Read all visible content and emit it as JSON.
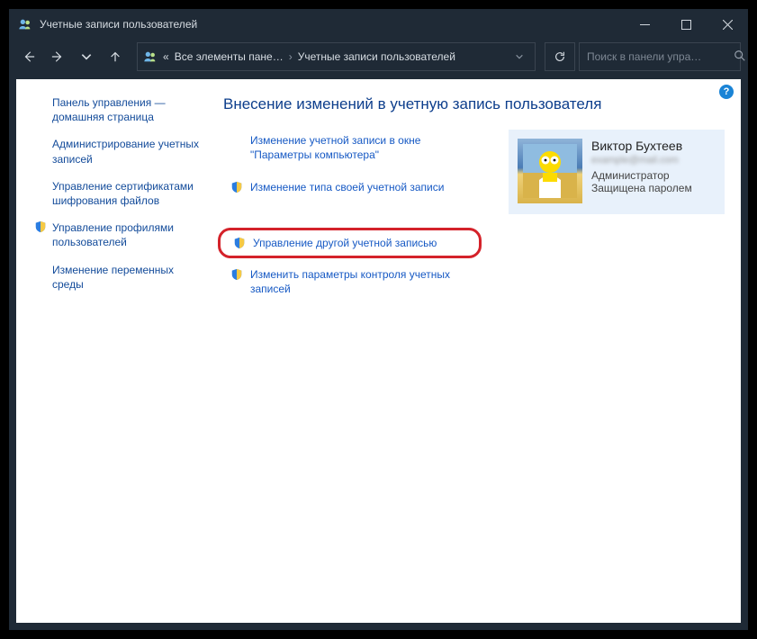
{
  "window": {
    "title": "Учетные записи пользователей"
  },
  "breadcrumb": {
    "prefix": "«",
    "item1": "Все элементы пане…",
    "item2": "Учетные записи пользователей"
  },
  "search": {
    "placeholder": "Поиск в панели упра…"
  },
  "sidebar": {
    "items": [
      {
        "label": "Панель управления — домашняя страница",
        "shield": false
      },
      {
        "label": "Администрирование учетных записей",
        "shield": false
      },
      {
        "label": "Управление сертификатами шифрования файлов",
        "shield": false
      },
      {
        "label": "Управление профилями пользователей",
        "shield": true
      },
      {
        "label": "Изменение переменных среды",
        "shield": false
      }
    ]
  },
  "main": {
    "heading": "Внесение изменений в учетную запись пользователя",
    "actions": [
      {
        "label": "Изменение учетной записи в окне \"Параметры компьютера\"",
        "shield": false,
        "highlighted": false
      },
      {
        "label": "Изменение типа своей учетной записи",
        "shield": true,
        "highlighted": false
      },
      {
        "label": "Управление другой учетной записью",
        "shield": true,
        "highlighted": true
      },
      {
        "label": "Изменить параметры контроля учетных записей",
        "shield": true,
        "highlighted": false
      }
    ],
    "user": {
      "name": "Виктор Бухтеев",
      "email": "example@mail.com",
      "role": "Администратор",
      "protected": "Защищена паролем"
    }
  },
  "help": {
    "label": "?"
  }
}
